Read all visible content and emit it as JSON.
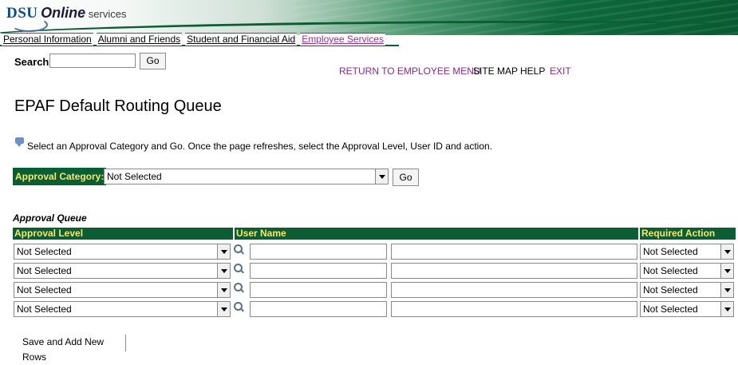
{
  "header": {
    "logo_dsu": "DSU",
    "logo_online": "Online",
    "logo_services": "services",
    "tabs": [
      {
        "label": "Personal Information",
        "active": false
      },
      {
        "label": "Alumni and Friends",
        "active": false
      },
      {
        "label": "Student and Financial Aid",
        "active": false
      },
      {
        "label": "Employee Services",
        "active": true
      }
    ]
  },
  "search": {
    "label": "Search",
    "value": "",
    "go_label": "Go"
  },
  "nav": {
    "return_label": "RETURN TO EMPLOYEE MENU",
    "sitemap_label": "SITE MAP",
    "help_label": "HELP",
    "exit_label": "EXIT"
  },
  "page": {
    "title": "EPAF Default Routing Queue",
    "info_text": "Select an Approval Category and Go. Once the page refreshes, select the Approval Level, User ID and action."
  },
  "category": {
    "label": "Approval Category:",
    "selected": "Not Selected",
    "go_label": "Go"
  },
  "queue": {
    "caption": "Approval Queue",
    "headers": {
      "level": "Approval Level",
      "user": "User Name",
      "action": "Required Action"
    },
    "rows": [
      {
        "level": "Not Selected",
        "user_id": "",
        "user_name": "",
        "action": "Not Selected"
      },
      {
        "level": "Not Selected",
        "user_id": "",
        "user_name": "",
        "action": "Not Selected"
      },
      {
        "level": "Not Selected",
        "user_id": "",
        "user_name": "",
        "action": "Not Selected"
      },
      {
        "level": "Not Selected",
        "user_id": "",
        "user_name": "",
        "action": "Not Selected"
      }
    ],
    "save_label": "Save and Add New Rows"
  },
  "colors": {
    "header_green": "#0b5e34",
    "label_yellow": "#f6e86a",
    "link_purple": "#8b2a86"
  }
}
